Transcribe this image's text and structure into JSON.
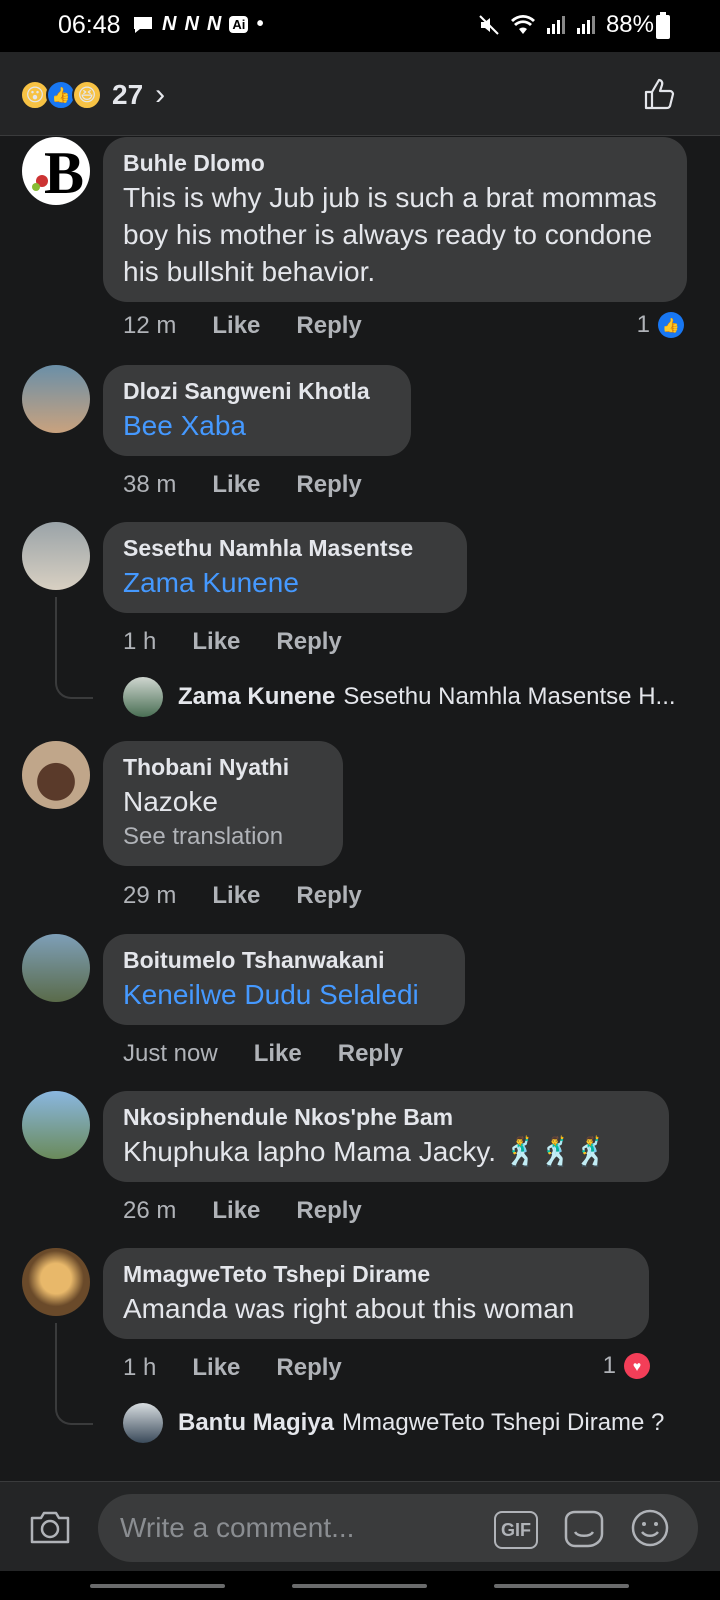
{
  "status_bar": {
    "time": "06:48",
    "notif_icons": [
      "N",
      "N",
      "N"
    ],
    "ai_label": "Ai",
    "battery": "88%"
  },
  "header": {
    "reaction_count": "27"
  },
  "comments": [
    {
      "name": "Buhle Dlomo",
      "text": "This is why Jub jub is such a brat mommas boy his mother is always ready to condone his bullshit behavior.",
      "time": "12 m",
      "like": "Like",
      "reply": "Reply",
      "reaction_count": "1",
      "reaction_type": "like"
    },
    {
      "name": "Dlozi Sangweni Khotla",
      "mention": "Bee Xaba",
      "time": "38 m",
      "like": "Like",
      "reply": "Reply"
    },
    {
      "name": "Sesethu Namhla Masentse",
      "mention": "Zama Kunene",
      "time": "1 h",
      "like": "Like",
      "reply": "Reply",
      "reply_preview": {
        "name": "Zama Kunene",
        "text": "Sesethu Namhla Masentse H..."
      }
    },
    {
      "name": "Thobani Nyathi",
      "text": "Nazoke",
      "translate": "See translation",
      "time": "29 m",
      "like": "Like",
      "reply": "Reply"
    },
    {
      "name": "Boitumelo Tshanwakani",
      "mention": "Keneilwe Dudu Selaledi",
      "time": "Just now",
      "like": "Like",
      "reply": "Reply"
    },
    {
      "name": "Nkosiphendule Nkos'phe Bam",
      "text": "Khuphuka lapho Mama Jacky. 🕺🕺🕺",
      "time": "26 m",
      "like": "Like",
      "reply": "Reply"
    },
    {
      "name": "MmagweTeto Tshepi Dirame",
      "text": "Amanda was right about this woman",
      "time": "1 h",
      "like": "Like",
      "reply": "Reply",
      "reaction_count": "1",
      "reaction_type": "love",
      "reply_preview": {
        "name": "Bantu Magiya",
        "text": "MmagweTeto Tshepi Dirame ?"
      }
    }
  ],
  "composer": {
    "placeholder": "Write a comment...",
    "gif_label": "GIF"
  },
  "colors": {
    "background": "#18191a",
    "bubble": "#3a3b3c",
    "mention": "#4599ff",
    "like_blue": "#1877f2",
    "love_red": "#f33e58"
  }
}
